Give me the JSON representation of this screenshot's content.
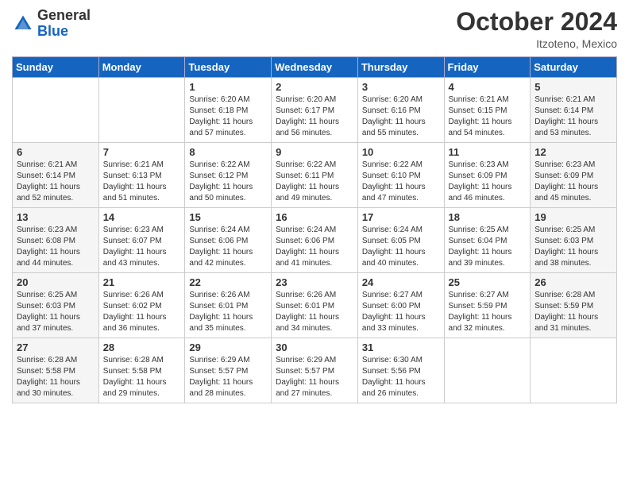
{
  "header": {
    "logo_general": "General",
    "logo_blue": "Blue",
    "month_title": "October 2024",
    "location": "Itzoteno, Mexico"
  },
  "weekdays": [
    "Sunday",
    "Monday",
    "Tuesday",
    "Wednesday",
    "Thursday",
    "Friday",
    "Saturday"
  ],
  "weeks": [
    [
      {
        "day": "",
        "sunrise": "",
        "sunset": "",
        "daylight": ""
      },
      {
        "day": "",
        "sunrise": "",
        "sunset": "",
        "daylight": ""
      },
      {
        "day": "1",
        "sunrise": "Sunrise: 6:20 AM",
        "sunset": "Sunset: 6:18 PM",
        "daylight": "Daylight: 11 hours and 57 minutes."
      },
      {
        "day": "2",
        "sunrise": "Sunrise: 6:20 AM",
        "sunset": "Sunset: 6:17 PM",
        "daylight": "Daylight: 11 hours and 56 minutes."
      },
      {
        "day": "3",
        "sunrise": "Sunrise: 6:20 AM",
        "sunset": "Sunset: 6:16 PM",
        "daylight": "Daylight: 11 hours and 55 minutes."
      },
      {
        "day": "4",
        "sunrise": "Sunrise: 6:21 AM",
        "sunset": "Sunset: 6:15 PM",
        "daylight": "Daylight: 11 hours and 54 minutes."
      },
      {
        "day": "5",
        "sunrise": "Sunrise: 6:21 AM",
        "sunset": "Sunset: 6:14 PM",
        "daylight": "Daylight: 11 hours and 53 minutes."
      }
    ],
    [
      {
        "day": "6",
        "sunrise": "Sunrise: 6:21 AM",
        "sunset": "Sunset: 6:14 PM",
        "daylight": "Daylight: 11 hours and 52 minutes."
      },
      {
        "day": "7",
        "sunrise": "Sunrise: 6:21 AM",
        "sunset": "Sunset: 6:13 PM",
        "daylight": "Daylight: 11 hours and 51 minutes."
      },
      {
        "day": "8",
        "sunrise": "Sunrise: 6:22 AM",
        "sunset": "Sunset: 6:12 PM",
        "daylight": "Daylight: 11 hours and 50 minutes."
      },
      {
        "day": "9",
        "sunrise": "Sunrise: 6:22 AM",
        "sunset": "Sunset: 6:11 PM",
        "daylight": "Daylight: 11 hours and 49 minutes."
      },
      {
        "day": "10",
        "sunrise": "Sunrise: 6:22 AM",
        "sunset": "Sunset: 6:10 PM",
        "daylight": "Daylight: 11 hours and 47 minutes."
      },
      {
        "day": "11",
        "sunrise": "Sunrise: 6:23 AM",
        "sunset": "Sunset: 6:09 PM",
        "daylight": "Daylight: 11 hours and 46 minutes."
      },
      {
        "day": "12",
        "sunrise": "Sunrise: 6:23 AM",
        "sunset": "Sunset: 6:09 PM",
        "daylight": "Daylight: 11 hours and 45 minutes."
      }
    ],
    [
      {
        "day": "13",
        "sunrise": "Sunrise: 6:23 AM",
        "sunset": "Sunset: 6:08 PM",
        "daylight": "Daylight: 11 hours and 44 minutes."
      },
      {
        "day": "14",
        "sunrise": "Sunrise: 6:23 AM",
        "sunset": "Sunset: 6:07 PM",
        "daylight": "Daylight: 11 hours and 43 minutes."
      },
      {
        "day": "15",
        "sunrise": "Sunrise: 6:24 AM",
        "sunset": "Sunset: 6:06 PM",
        "daylight": "Daylight: 11 hours and 42 minutes."
      },
      {
        "day": "16",
        "sunrise": "Sunrise: 6:24 AM",
        "sunset": "Sunset: 6:06 PM",
        "daylight": "Daylight: 11 hours and 41 minutes."
      },
      {
        "day": "17",
        "sunrise": "Sunrise: 6:24 AM",
        "sunset": "Sunset: 6:05 PM",
        "daylight": "Daylight: 11 hours and 40 minutes."
      },
      {
        "day": "18",
        "sunrise": "Sunrise: 6:25 AM",
        "sunset": "Sunset: 6:04 PM",
        "daylight": "Daylight: 11 hours and 39 minutes."
      },
      {
        "day": "19",
        "sunrise": "Sunrise: 6:25 AM",
        "sunset": "Sunset: 6:03 PM",
        "daylight": "Daylight: 11 hours and 38 minutes."
      }
    ],
    [
      {
        "day": "20",
        "sunrise": "Sunrise: 6:25 AM",
        "sunset": "Sunset: 6:03 PM",
        "daylight": "Daylight: 11 hours and 37 minutes."
      },
      {
        "day": "21",
        "sunrise": "Sunrise: 6:26 AM",
        "sunset": "Sunset: 6:02 PM",
        "daylight": "Daylight: 11 hours and 36 minutes."
      },
      {
        "day": "22",
        "sunrise": "Sunrise: 6:26 AM",
        "sunset": "Sunset: 6:01 PM",
        "daylight": "Daylight: 11 hours and 35 minutes."
      },
      {
        "day": "23",
        "sunrise": "Sunrise: 6:26 AM",
        "sunset": "Sunset: 6:01 PM",
        "daylight": "Daylight: 11 hours and 34 minutes."
      },
      {
        "day": "24",
        "sunrise": "Sunrise: 6:27 AM",
        "sunset": "Sunset: 6:00 PM",
        "daylight": "Daylight: 11 hours and 33 minutes."
      },
      {
        "day": "25",
        "sunrise": "Sunrise: 6:27 AM",
        "sunset": "Sunset: 5:59 PM",
        "daylight": "Daylight: 11 hours and 32 minutes."
      },
      {
        "day": "26",
        "sunrise": "Sunrise: 6:28 AM",
        "sunset": "Sunset: 5:59 PM",
        "daylight": "Daylight: 11 hours and 31 minutes."
      }
    ],
    [
      {
        "day": "27",
        "sunrise": "Sunrise: 6:28 AM",
        "sunset": "Sunset: 5:58 PM",
        "daylight": "Daylight: 11 hours and 30 minutes."
      },
      {
        "day": "28",
        "sunrise": "Sunrise: 6:28 AM",
        "sunset": "Sunset: 5:58 PM",
        "daylight": "Daylight: 11 hours and 29 minutes."
      },
      {
        "day": "29",
        "sunrise": "Sunrise: 6:29 AM",
        "sunset": "Sunset: 5:57 PM",
        "daylight": "Daylight: 11 hours and 28 minutes."
      },
      {
        "day": "30",
        "sunrise": "Sunrise: 6:29 AM",
        "sunset": "Sunset: 5:57 PM",
        "daylight": "Daylight: 11 hours and 27 minutes."
      },
      {
        "day": "31",
        "sunrise": "Sunrise: 6:30 AM",
        "sunset": "Sunset: 5:56 PM",
        "daylight": "Daylight: 11 hours and 26 minutes."
      },
      {
        "day": "",
        "sunrise": "",
        "sunset": "",
        "daylight": ""
      },
      {
        "day": "",
        "sunrise": "",
        "sunset": "",
        "daylight": ""
      }
    ]
  ]
}
